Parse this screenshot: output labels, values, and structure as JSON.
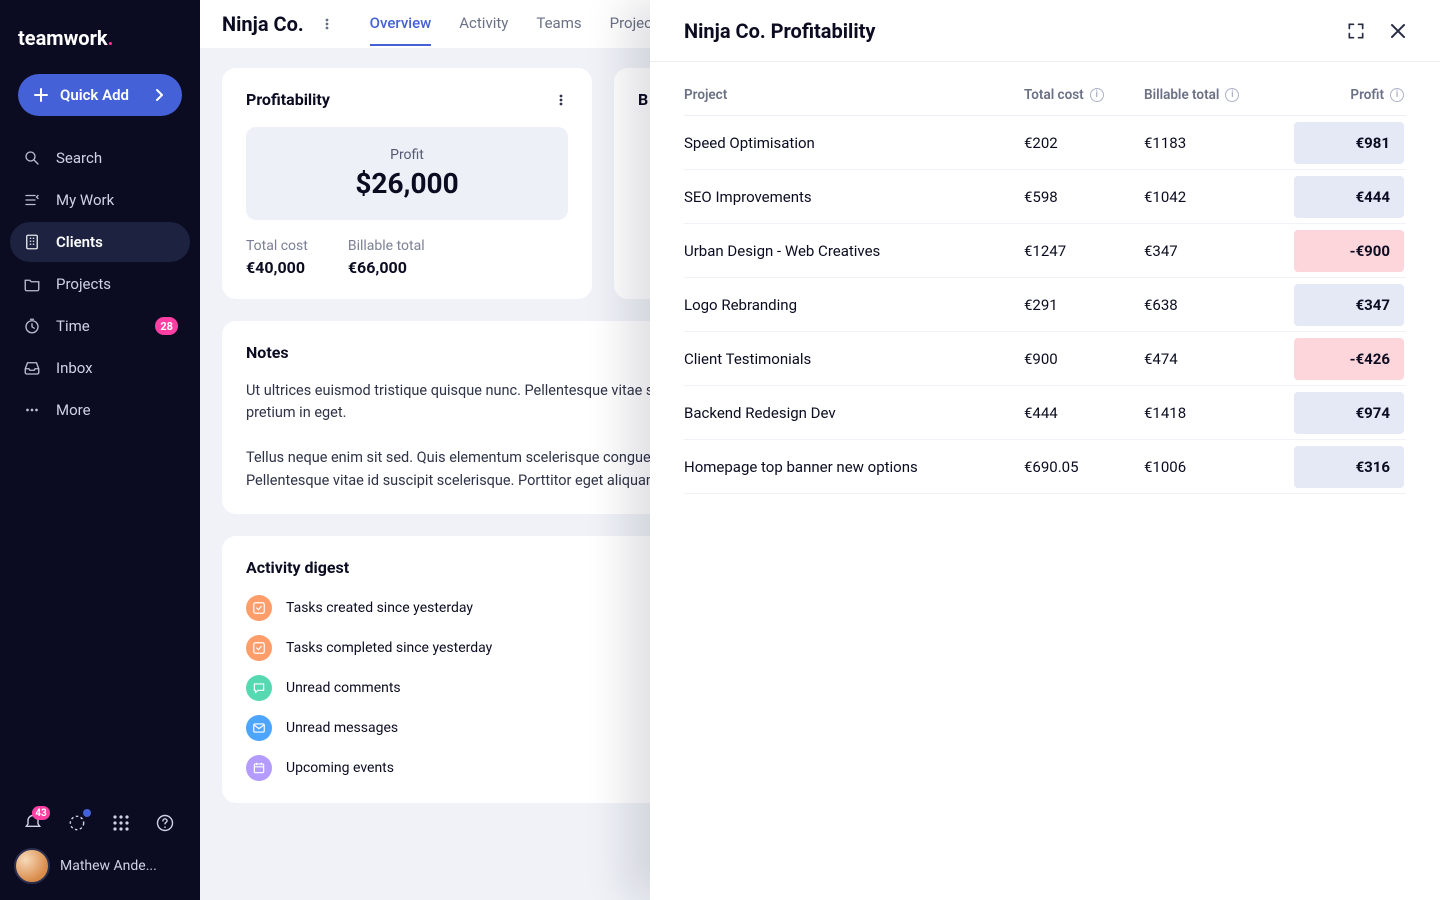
{
  "brand": {
    "name": "teamwork",
    "accent_dot": "."
  },
  "sidebar": {
    "quick_add": "Quick Add",
    "items": [
      {
        "label": "Search",
        "icon": "search-icon"
      },
      {
        "label": "My Work",
        "icon": "mywork-icon"
      },
      {
        "label": "Clients",
        "icon": "clients-icon",
        "active": true
      },
      {
        "label": "Projects",
        "icon": "projects-icon"
      },
      {
        "label": "Time",
        "icon": "time-icon",
        "badge": "28"
      },
      {
        "label": "Inbox",
        "icon": "inbox-icon"
      },
      {
        "label": "More",
        "icon": "more-icon"
      }
    ],
    "notification_count": "43",
    "user_name": "Mathew Ande..."
  },
  "header": {
    "client": "Ninja Co.",
    "tabs": [
      "Overview",
      "Activity",
      "Teams",
      "Projects"
    ],
    "active_tab": "Overview"
  },
  "profitability_card": {
    "title": "Profitability",
    "profit_label": "Profit",
    "profit_value": "$26,000",
    "total_cost_label": "Total cost",
    "total_cost_value": "€40,000",
    "billable_label": "Billable total",
    "billable_value": "€66,000"
  },
  "secondary_card_first_letter": "B",
  "notes": {
    "title": "Notes",
    "body": "Ut ultrices euismod tristique quisque nunc. Pellentesque vitae suscipit scelerisque. Porttitor eget aliquam pretium in eget.\n\nTellus neque enim sit sed. Quis elementum scelerisque congue et.Ut ultrices euismod tristique quisque nunc. Pellentesque vitae id suscipit scelerisque. Porttitor eget aliquam pretium in eget."
  },
  "activity": {
    "title": "Activity digest",
    "items": [
      {
        "label": "Tasks created since yesterday",
        "color": "c-orange",
        "icon": "check-icon"
      },
      {
        "label": "Tasks completed since yesterday",
        "color": "c-orange",
        "icon": "check-icon"
      },
      {
        "label": "Unread comments",
        "color": "c-teal",
        "icon": "comment-icon"
      },
      {
        "label": "Unread messages",
        "color": "c-blue",
        "icon": "mail-icon"
      },
      {
        "label": "Upcoming events",
        "color": "c-purple",
        "icon": "calendar-icon"
      }
    ]
  },
  "drawer": {
    "title": "Ninja Co. Profitability",
    "columns": {
      "project": "Project",
      "total_cost": "Total cost",
      "billable": "Billable total",
      "profit": "Profit"
    },
    "rows": [
      {
        "project": "Speed Optimisation",
        "total_cost": "€202",
        "billable": "€1183",
        "profit": "€981",
        "negative": false
      },
      {
        "project": "SEO Improvements",
        "total_cost": "€598",
        "billable": "€1042",
        "profit": "€444",
        "negative": false
      },
      {
        "project": "Urban Design - Web Creatives",
        "total_cost": "€1247",
        "billable": "€347",
        "profit": "-€900",
        "negative": true
      },
      {
        "project": "Logo Rebranding",
        "total_cost": "€291",
        "billable": "€638",
        "profit": "€347",
        "negative": false
      },
      {
        "project": "Client Testimonials",
        "total_cost": "€900",
        "billable": "€474",
        "profit": "-€426",
        "negative": true
      },
      {
        "project": "Backend Redesign Dev",
        "total_cost": "€444",
        "billable": "€1418",
        "profit": "€974",
        "negative": false
      },
      {
        "project": "Homepage top banner new options",
        "total_cost": "€690.05",
        "billable": "€1006",
        "profit": "€316",
        "negative": false
      }
    ]
  },
  "chart_data": {
    "type": "table",
    "title": "Ninja Co. Profitability",
    "columns": [
      "Project",
      "Total cost (EUR)",
      "Billable total (EUR)",
      "Profit (EUR)"
    ],
    "rows": [
      [
        "Speed Optimisation",
        202,
        1183,
        981
      ],
      [
        "SEO Improvements",
        598,
        1042,
        444
      ],
      [
        "Urban Design - Web Creatives",
        1247,
        347,
        -900
      ],
      [
        "Logo Rebranding",
        291,
        638,
        347
      ],
      [
        "Client Testimonials",
        900,
        474,
        -426
      ],
      [
        "Backend Redesign Dev",
        444,
        1418,
        974
      ],
      [
        "Homepage top banner new options",
        690.05,
        1006,
        316
      ]
    ]
  }
}
